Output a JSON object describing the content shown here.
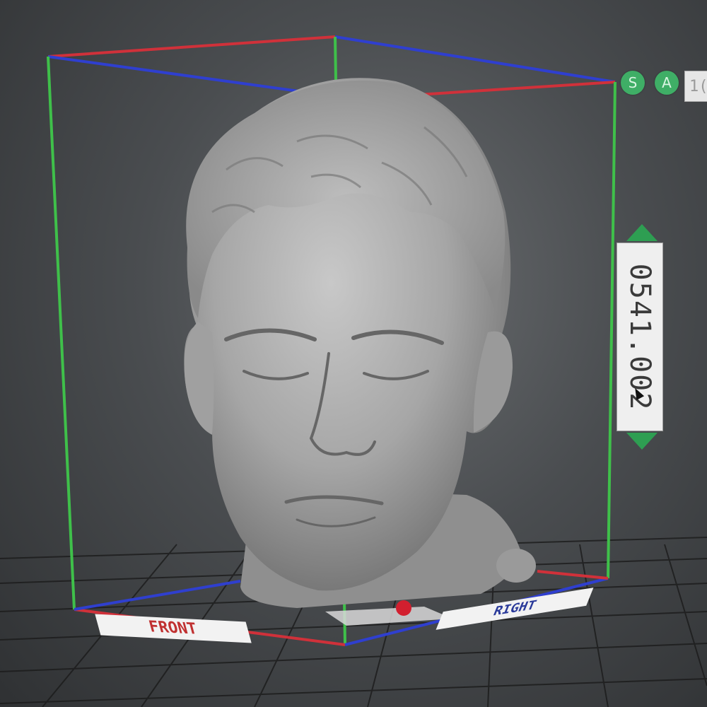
{
  "toolbar": {
    "view_buttons": [
      {
        "label": "S"
      },
      {
        "label": "A"
      }
    ],
    "top_field_value": "1("
  },
  "height_control": {
    "value": "0541.002"
  },
  "labels": {
    "front": "FRONT",
    "right": "RIGHT"
  },
  "colors": {
    "axis_x": "#d0313a",
    "axis_y": "#2f3fcf",
    "axis_z": "#3fc04a",
    "button_green": "#3fae66",
    "model_gray": "#a9a9a9"
  },
  "icons": [
    "cursor-arrow-icon",
    "arrow-up-icon",
    "arrow-down-icon"
  ]
}
